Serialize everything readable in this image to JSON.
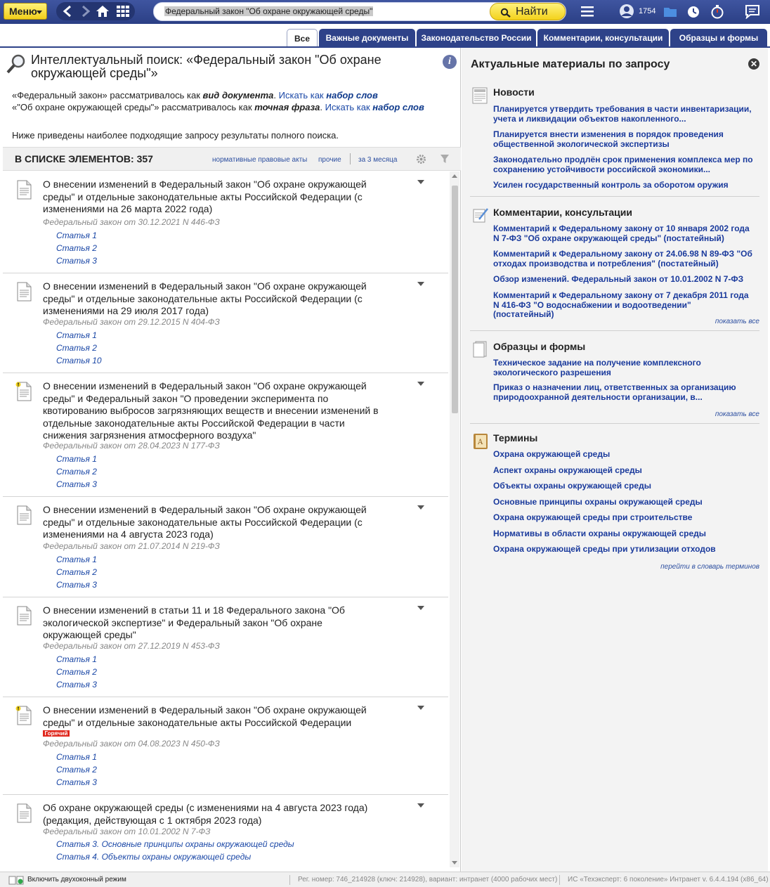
{
  "topbar": {
    "menu_label": "Меню",
    "search_value": "Федеральный закон \"Об охране окружающей среды\"",
    "find_label": "Найти",
    "user_count": "1754"
  },
  "tabs": [
    {
      "label": "Все",
      "active": true
    },
    {
      "label": "Важные документы",
      "active": false
    },
    {
      "label": "Законодательство России",
      "active": false
    },
    {
      "label": "Комментарии, консультации",
      "active": false
    },
    {
      "label": "Образцы и формы",
      "active": false
    }
  ],
  "search_info": {
    "title": "Интеллектуальный поиск: «Федеральный закон \"Об охране окружающей среды\"»",
    "line1_pre": "«Федеральный закон» рассматривалось как ",
    "line1_em": "вид документа",
    "line1_mid": ". ",
    "line1_link": "Искать как ",
    "line1_link_bold": "набор слов",
    "line2_pre": "«\"Об охране окружающей среды\"» рассматривалось как ",
    "line2_em": "точная фраза",
    "line2_mid": ". ",
    "line2_link": "Искать как ",
    "line2_link_bold": "набор слов",
    "subtitle": "Ниже приведены наиболее подходящие запросу результаты полного поиска."
  },
  "list_header": {
    "count_label": "В СПИСКЕ ЭЛЕМЕНТОВ: 357",
    "filter1": "нормативные правовые акты",
    "filter2": "прочие",
    "filter3": "за 3 месяца"
  },
  "documents": [
    {
      "title": "О внесении изменений в Федеральный закон \"Об охране окружающей среды\" и отдельные законодательные акты Российской Федерации (с изменениями на 26 марта 2022 года)",
      "meta": "Федеральный закон от 30.12.2021 N 446-ФЗ",
      "articles": [
        "Статья 1",
        "Статья 2",
        "Статья 3"
      ]
    },
    {
      "title": "О внесении изменений в Федеральный закон \"Об охране окружающей среды\" и отдельные законодательные акты Российской Федерации (с изменениями на 29 июля 2017 года)",
      "meta": "Федеральный закон от 29.12.2015 N 404-ФЗ",
      "articles": [
        "Статья 1",
        "Статья 2",
        "Статья 10"
      ]
    },
    {
      "title": "О внесении изменений в Федеральный закон \"Об охране окружающей среды\" и Федеральный закон \"О проведении эксперимента по квотированию выбросов загрязняющих веществ и внесении изменений в отдельные законодательные акты Российской Федерации в части снижения загрязнения атмосферного воздуха\"",
      "meta": "Федеральный закон от 28.04.2023 N 177-ФЗ",
      "articles": [
        "Статья 1",
        "Статья 2",
        "Статья 3"
      ]
    },
    {
      "title": "О внесении изменений в Федеральный закон \"Об охране окружающей среды\" и отдельные законодательные акты Российской Федерации (с изменениями на 4 августа 2023 года)",
      "meta": "Федеральный закон от 21.07.2014 N 219-ФЗ",
      "articles": [
        "Статья 1",
        "Статья 2",
        "Статья 3"
      ]
    },
    {
      "title": "О внесении изменений в статьи 11 и 18 Федерального закона \"Об экологической экспертизе\" и Федеральный закон \"Об охране окружающей среды\"",
      "meta": "Федеральный закон от 27.12.2019 N 453-ФЗ",
      "articles": [
        "Статья 1",
        "Статья 2",
        "Статья 3"
      ]
    },
    {
      "title": "О внесении изменений в Федеральный закон \"Об охране окружающей среды\" и отдельные законодательные акты Российской Федерации",
      "badge": "Горячий",
      "meta": "Федеральный закон от 04.08.2023 N 450-ФЗ",
      "articles": [
        "Статья 1",
        "Статья 2",
        "Статья 3"
      ]
    },
    {
      "title": "Об охране окружающей среды (с изменениями на 4 августа 2023 года) (редакция, действующая с 1 октября 2023 года)",
      "meta": "Федеральный закон от 10.01.2002 N 7-ФЗ",
      "articles": [
        "Статья 3. Основные принципы охраны окружающей среды",
        "Статья 4. Объекты охраны окружающей среды"
      ]
    }
  ],
  "right_panel": {
    "title": "Актуальные материалы по запросу",
    "news": {
      "title": "Новости",
      "items": [
        "Планируется утвердить требования в части инвентаризации, учета и ликвидации объектов накопленного...",
        "Планируется внести изменения в порядок проведения общественной экологической экспертизы",
        "Законодательно продлён срок применения комплекса мер по сохранению устойчивости российской экономики...",
        "Усилен государственный контроль за оборотом оружия"
      ]
    },
    "comments": {
      "title": "Комментарии, консультации",
      "items": [
        "Комментарий к Федеральному закону от 10 января 2002 года N 7-ФЗ \"Об охране окружающей среды\" (постатейный)",
        "Комментарий к Федеральному закону от 24.06.98 N 89-ФЗ \"Об отходах производства и потребления\" (постатейный)",
        "Обзор изменений. Федеральный закон от 10.01.2002 N 7-ФЗ",
        "Комментарий к Федеральному закону от 7 декабря 2011 года N 416-ФЗ \"О водоснабжении и водоотведении\" (постатейный)"
      ],
      "more": "показать все"
    },
    "forms": {
      "title": "Образцы и формы",
      "items": [
        "Техническое задание на получение комплексного экологического разрешения",
        "Приказ о назначении лиц, ответственных за организацию природоохранной деятельности организации, в..."
      ],
      "more": "показать все"
    },
    "terms": {
      "title": "Термины",
      "items": [
        "Охрана окружающей среды",
        "Аспект охраны окружающей среды",
        "Объекты охраны окружающей среды",
        "Основные принципы охраны окружающей среды",
        "Охрана окружающей среды при строительстве",
        "Нормативы в области охраны окружающей среды",
        "Охрана окружающей среды при утилизации отходов"
      ],
      "more": "перейти в словарь терминов"
    }
  },
  "statusbar": {
    "dual_mode": "Включить двухоконный режим",
    "reg": "Рег. номер: 746_214928 (ключ: 214928), вариант: интранет (4000 рабочих мест)",
    "version": "ИС «Техэксперт: 6 поколение» Интранет v. 6.4.4.194 (x86_64)"
  },
  "colors": {
    "topbar": "#2e4289",
    "accent_yellow": "#f3d21c",
    "link": "#1a47a6",
    "hot_badge": "#e0281e"
  }
}
